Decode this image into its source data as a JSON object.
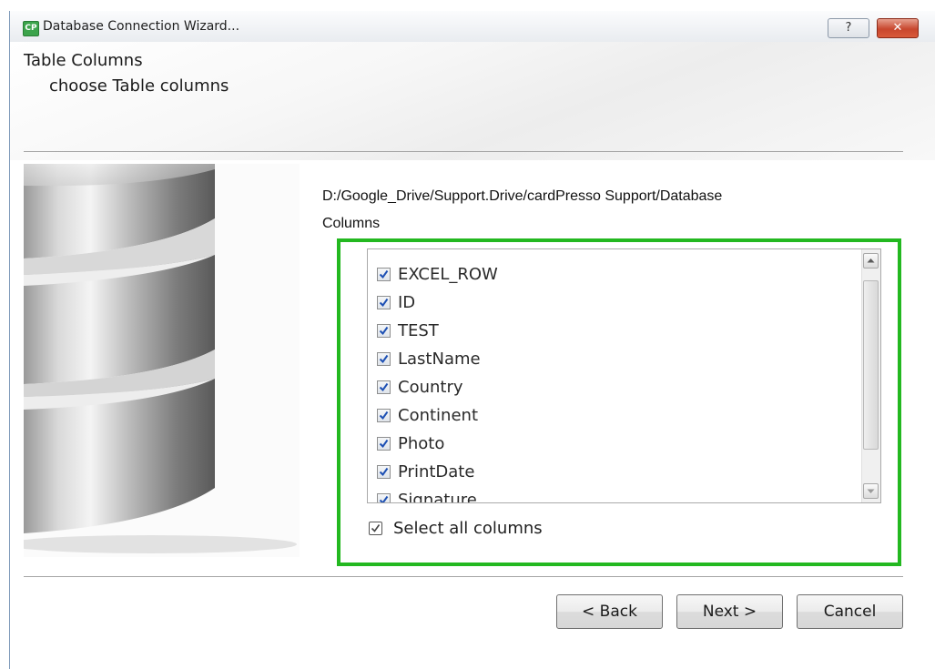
{
  "window": {
    "title": "Database Connection Wizard...",
    "app_icon_text": "CP",
    "help_label": "?",
    "close_label": "✕"
  },
  "header": {
    "title": "Table Columns",
    "subtitle": "choose Table columns"
  },
  "path": "D:/Google_Drive/Support.Drive/cardPresso Support/Database",
  "columns_label": "Columns",
  "columns": [
    {
      "name": "EXCEL_ROW",
      "checked": true
    },
    {
      "name": "ID",
      "checked": true
    },
    {
      "name": "TEST",
      "checked": true
    },
    {
      "name": "LastName",
      "checked": true
    },
    {
      "name": "Country",
      "checked": true
    },
    {
      "name": "Continent",
      "checked": true
    },
    {
      "name": "Photo",
      "checked": true
    },
    {
      "name": "PrintDate",
      "checked": true
    },
    {
      "name": "Signature",
      "checked": true
    }
  ],
  "select_all": {
    "label": "Select all columns",
    "checked": true
  },
  "buttons": {
    "back": "< Back",
    "next": "Next >",
    "cancel": "Cancel"
  },
  "colors": {
    "highlight": "#23b820",
    "checkmark": "#1c4fb3"
  }
}
